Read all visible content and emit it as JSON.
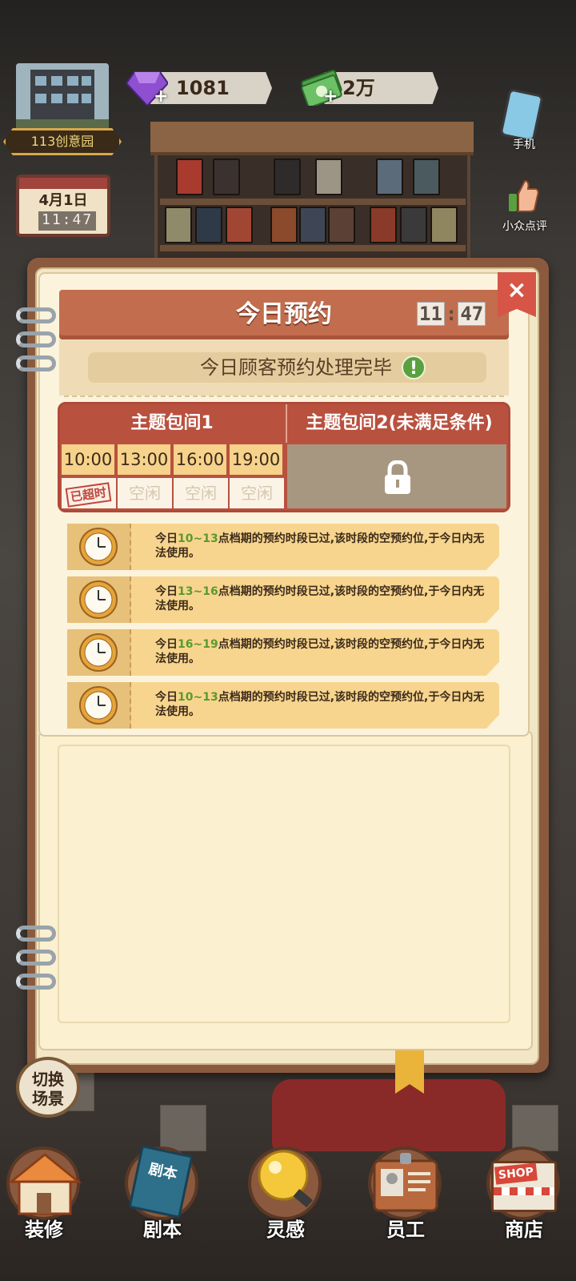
{
  "hud": {
    "location_label": "113创意园",
    "gems": "1081",
    "cash": "2万",
    "plus": "+",
    "calendar_date": "4月1日",
    "calendar_time": "11:47",
    "phone_label": "手机",
    "review_label": "小众点评"
  },
  "dialog": {
    "title": "今日预约",
    "time_hh": "11",
    "time_mm": "47",
    "close": "×",
    "status": "今日顾客预约处理完毕",
    "status_icon": "!"
  },
  "rooms": {
    "room1": {
      "name": "主题包间1",
      "slots": [
        {
          "time": "10:00",
          "state": "已超时"
        },
        {
          "time": "13:00",
          "state": "空闲"
        },
        {
          "time": "16:00",
          "state": "空闲"
        },
        {
          "time": "19:00",
          "state": "空闲"
        }
      ]
    },
    "room2": {
      "name": "主题包间2(未满足条件)"
    }
  },
  "notices": [
    {
      "pre": "今日",
      "range": "10~13",
      "post": "点档期的预约时段已过,该时段的空预约位,于今日内无法使用。"
    },
    {
      "pre": "今日",
      "range": "13~16",
      "post": "点档期的预约时段已过,该时段的空预约位,于今日内无法使用。"
    },
    {
      "pre": "今日",
      "range": "16~19",
      "post": "点档期的预约时段已过,该时段的空预约位,于今日内无法使用。"
    },
    {
      "pre": "今日",
      "range": "10~13",
      "post": "点档期的预约时段已过,该时段的空预约位,于今日内无法使用。"
    }
  ],
  "switch_scene": {
    "line1": "切换",
    "line2": "场景"
  },
  "nav": {
    "decorate": "装修",
    "script": "剧本",
    "script_book": "剧本",
    "inspiration": "灵感",
    "staff": "员工",
    "shop": "商店",
    "shop_sign": "SHOP"
  },
  "colors": {
    "header": "#c26d4d",
    "accent_green": "#5a9a2e",
    "overtime_red": "#c0463b",
    "slot_yellow": "#f6d28b"
  }
}
